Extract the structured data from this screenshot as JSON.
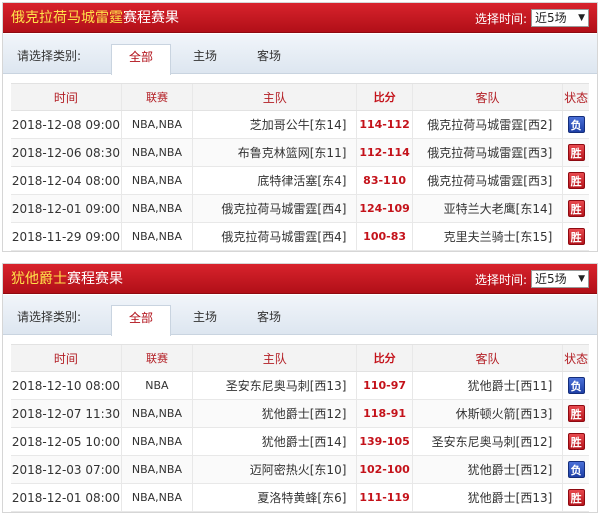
{
  "colors": {
    "header": "#c41a23",
    "team_highlight": "#ffe14a",
    "win": "#c4121a",
    "lose": "#1e3fa6",
    "score": "#c4121a"
  },
  "panels": [
    {
      "team": "俄克拉荷马城雷霆",
      "title_suffix": "赛程赛果",
      "range_label": "选择时间:",
      "range_value": "近5场",
      "filter_label": "请选择类别:",
      "tabs": [
        "全部",
        "主场",
        "客场"
      ],
      "active_tab": "全部",
      "columns": [
        "时间",
        "联赛",
        "主队",
        "比分",
        "客队",
        "状态"
      ],
      "rows": [
        {
          "time": "2018-12-08 09:00",
          "league": "NBA,NBA",
          "home": "芝加哥公牛[东14]",
          "score": "114-112",
          "away": "俄克拉荷马城雷霆[西2]",
          "status": "负",
          "result": "lose"
        },
        {
          "time": "2018-12-06 08:30",
          "league": "NBA,NBA",
          "home": "布鲁克林篮网[东11]",
          "score": "112-114",
          "away": "俄克拉荷马城雷霆[西3]",
          "status": "胜",
          "result": "win"
        },
        {
          "time": "2018-12-04 08:00",
          "league": "NBA,NBA",
          "home": "底特律活塞[东4]",
          "score": "83-110",
          "away": "俄克拉荷马城雷霆[西3]",
          "status": "胜",
          "result": "win"
        },
        {
          "time": "2018-12-01 09:00",
          "league": "NBA,NBA",
          "home": "俄克拉荷马城雷霆[西4]",
          "score": "124-109",
          "away": "亚特兰大老鹰[东14]",
          "status": "胜",
          "result": "win"
        },
        {
          "time": "2018-11-29 09:00",
          "league": "NBA,NBA",
          "home": "俄克拉荷马城雷霆[西4]",
          "score": "100-83",
          "away": "克里夫兰骑士[东15]",
          "status": "胜",
          "result": "win"
        }
      ]
    },
    {
      "team": "犹他爵士",
      "title_suffix": "赛程赛果",
      "range_label": "选择时间:",
      "range_value": "近5场",
      "filter_label": "请选择类别:",
      "tabs": [
        "全部",
        "主场",
        "客场"
      ],
      "active_tab": "全部",
      "columns": [
        "时间",
        "联赛",
        "主队",
        "比分",
        "客队",
        "状态"
      ],
      "rows": [
        {
          "time": "2018-12-10 08:00",
          "league": "NBA",
          "home": "圣安东尼奥马刺[西13]",
          "score": "110-97",
          "away": "犹他爵士[西11]",
          "status": "负",
          "result": "lose"
        },
        {
          "time": "2018-12-07 11:30",
          "league": "NBA,NBA",
          "home": "犹他爵士[西12]",
          "score": "118-91",
          "away": "休斯顿火箭[西13]",
          "status": "胜",
          "result": "win"
        },
        {
          "time": "2018-12-05 10:00",
          "league": "NBA,NBA",
          "home": "犹他爵士[西14]",
          "score": "139-105",
          "away": "圣安东尼奥马刺[西12]",
          "status": "胜",
          "result": "win"
        },
        {
          "time": "2018-12-03 07:00",
          "league": "NBA,NBA",
          "home": "迈阿密热火[东10]",
          "score": "102-100",
          "away": "犹他爵士[西12]",
          "status": "负",
          "result": "lose"
        },
        {
          "time": "2018-12-01 08:00",
          "league": "NBA,NBA",
          "home": "夏洛特黄蜂[东6]",
          "score": "111-119",
          "away": "犹他爵士[西13]",
          "status": "胜",
          "result": "win"
        }
      ]
    }
  ]
}
